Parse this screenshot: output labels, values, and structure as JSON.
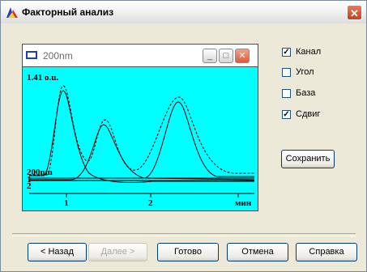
{
  "window": {
    "title": "Факторный анализ"
  },
  "inner_window": {
    "title": "200nm"
  },
  "plot": {
    "max_label": "1.41 o.u.",
    "series_label": "200nm",
    "marks": [
      "1",
      "2"
    ],
    "x_ticks": [
      "1",
      "2",
      "мин"
    ]
  },
  "options": [
    {
      "label": "Канал",
      "checked": true
    },
    {
      "label": "Угол",
      "checked": false
    },
    {
      "label": "База",
      "checked": false
    },
    {
      "label": "Сдвиг",
      "checked": true
    }
  ],
  "save_button": "Сохранить",
  "buttons": {
    "back": "< Назад",
    "next": "Далее >",
    "done": "Готово",
    "cancel": "Отмена",
    "help": "Справка"
  },
  "icons": {
    "app": "chart-app-icon",
    "close": "close-icon",
    "minimize": "minimize-icon",
    "maximize": "maximize-icon",
    "check": "checkmark-icon"
  },
  "colors": {
    "plot_bg": "#00ffff",
    "close_red": "#d2502c"
  }
}
